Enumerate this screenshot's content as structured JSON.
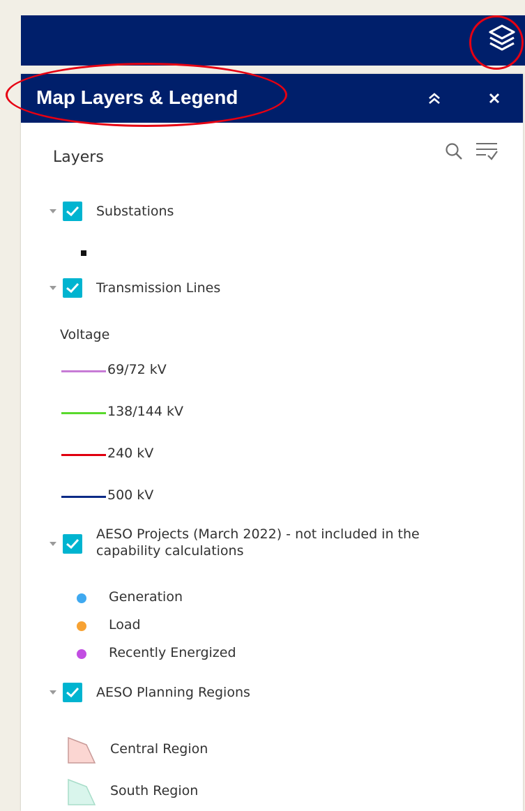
{
  "panel": {
    "title": "Map Layers & Legend"
  },
  "layer_list": {
    "title": "Layers",
    "layers": [
      {
        "label": "Substations"
      },
      {
        "label": "Transmission Lines"
      },
      {
        "label": "AESO Projects (March 2022) - not included in the capability calculations"
      },
      {
        "label": "AESO Planning Regions"
      }
    ]
  },
  "legend": {
    "voltage_heading": "Voltage",
    "voltage_items": [
      {
        "label": "69/72 kV",
        "color": "#c77bd6"
      },
      {
        "label": "138/144 kV",
        "color": "#59d92c"
      },
      {
        "label": "240 kV",
        "color": "#e0000f"
      },
      {
        "label": "500 kV",
        "color": "#0a2a86"
      }
    ],
    "project_items": [
      {
        "label": "Generation",
        "color": "#3fa9f0"
      },
      {
        "label": "Load",
        "color": "#f7a233"
      },
      {
        "label": "Recently Energized",
        "color": "#c24ee2"
      }
    ],
    "region_items": [
      {
        "label": "Central Region",
        "fill": "#fbd6d2",
        "stroke": "#c89a98"
      },
      {
        "label": "South Region",
        "fill": "#d9f5ec",
        "stroke": "#a8ddc9"
      }
    ]
  },
  "colors": {
    "header_navy": "#001f6b",
    "checkbox_cyan": "#00b4d0",
    "callout_red": "#e60012"
  },
  "icons": {
    "layers_button": "layers-stack-icon",
    "collapse": "double-chevron-up-icon",
    "close": "close-icon",
    "search": "search-icon",
    "filter": "filter-list-icon"
  }
}
